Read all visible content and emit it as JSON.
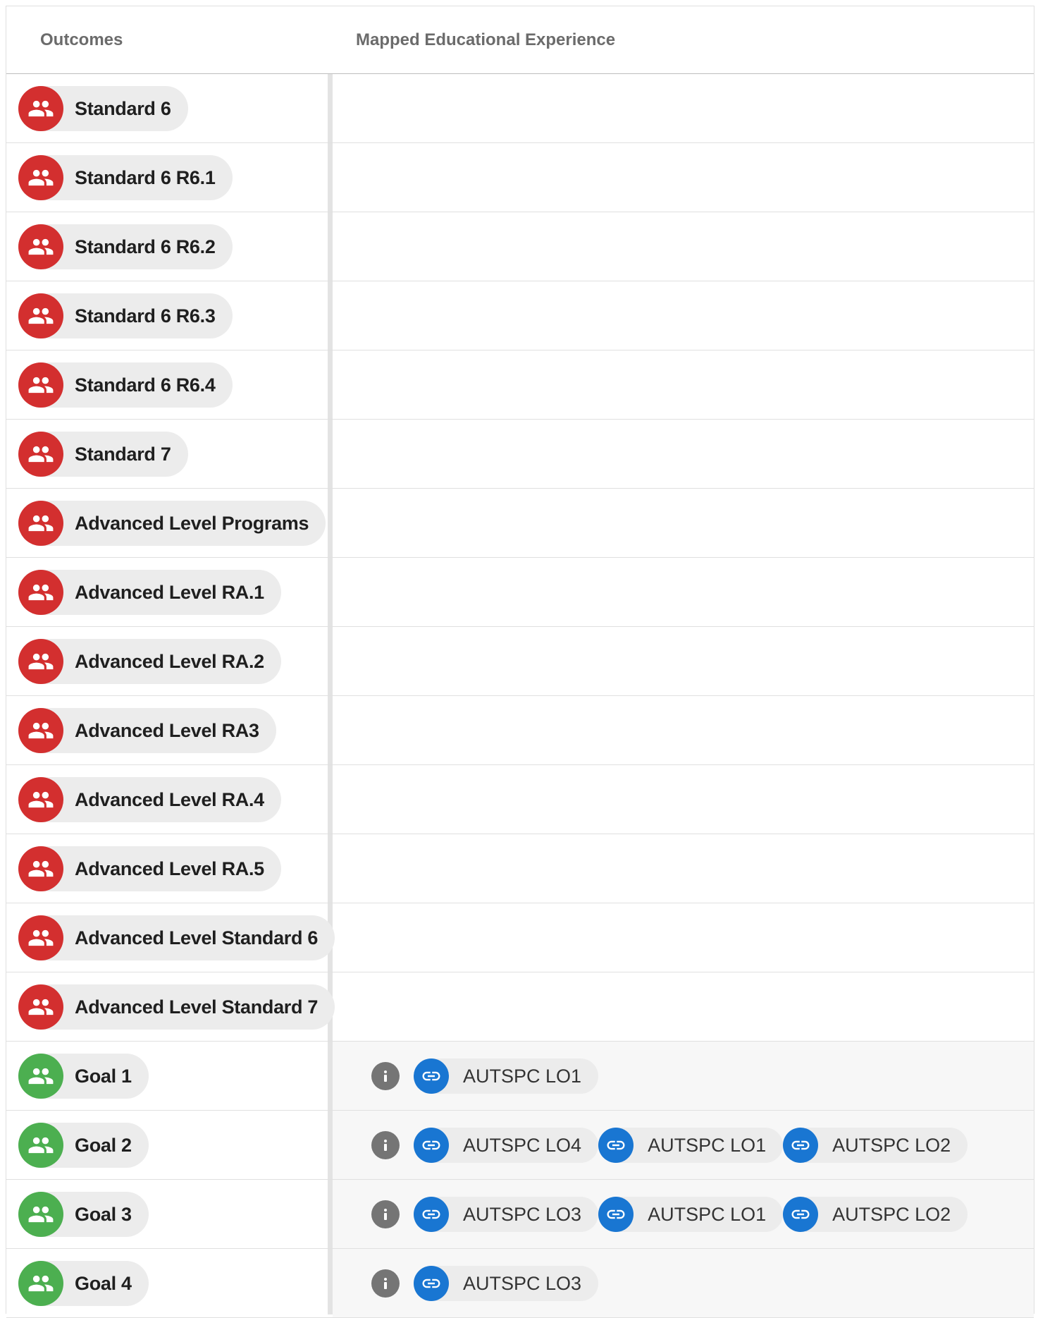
{
  "header": {
    "outcomes_label": "Outcomes",
    "mapped_label": "Mapped Educational Experience"
  },
  "colors": {
    "standard_avatar": "#d32f2f",
    "goal_avatar": "#4caf50",
    "link_icon": "#1976d2",
    "info_icon": "#757575"
  },
  "rows": [
    {
      "label": "Standard 6",
      "type": "standard",
      "mapped": []
    },
    {
      "label": "Standard 6 R6.1",
      "type": "standard",
      "mapped": []
    },
    {
      "label": "Standard 6 R6.2",
      "type": "standard",
      "mapped": []
    },
    {
      "label": "Standard 6 R6.3",
      "type": "standard",
      "mapped": []
    },
    {
      "label": "Standard 6 R6.4",
      "type": "standard",
      "mapped": []
    },
    {
      "label": "Standard 7",
      "type": "standard",
      "mapped": []
    },
    {
      "label": "Advanced Level Programs",
      "type": "standard",
      "mapped": []
    },
    {
      "label": "Advanced Level RA.1",
      "type": "standard",
      "mapped": []
    },
    {
      "label": "Advanced Level RA.2",
      "type": "standard",
      "mapped": []
    },
    {
      "label": "Advanced Level RA3",
      "type": "standard",
      "mapped": []
    },
    {
      "label": "Advanced Level RA.4",
      "type": "standard",
      "mapped": []
    },
    {
      "label": "Advanced Level RA.5",
      "type": "standard",
      "mapped": []
    },
    {
      "label": "Advanced Level Standard 6",
      "type": "standard",
      "mapped": []
    },
    {
      "label": "Advanced Level Standard 7",
      "type": "standard",
      "mapped": []
    },
    {
      "label": "Goal 1",
      "type": "goal",
      "mapped": [
        "AUTSPC LO1"
      ]
    },
    {
      "label": "Goal 2",
      "type": "goal",
      "mapped": [
        "AUTSPC LO4",
        "AUTSPC LO1",
        "AUTSPC LO2"
      ]
    },
    {
      "label": "Goal 3",
      "type": "goal",
      "mapped": [
        "AUTSPC LO3",
        "AUTSPC LO1",
        "AUTSPC LO2"
      ]
    },
    {
      "label": "Goal 4",
      "type": "goal",
      "mapped": [
        "AUTSPC LO3"
      ]
    }
  ]
}
